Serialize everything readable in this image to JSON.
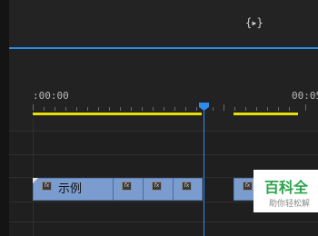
{
  "toolbar": {
    "snap_icon_text": "{▸}"
  },
  "timeline": {
    "timecode_start": ":00:00",
    "timecode_end": "00:05"
  },
  "clip": {
    "label": "示例",
    "fx_label": "fx"
  },
  "watermark": {
    "title": "百科全",
    "subtitle": "助你轻松解"
  },
  "colors": {
    "accent": "#2d8ceb",
    "work_area": "#e8e000",
    "clip": "#7b9ccf"
  }
}
